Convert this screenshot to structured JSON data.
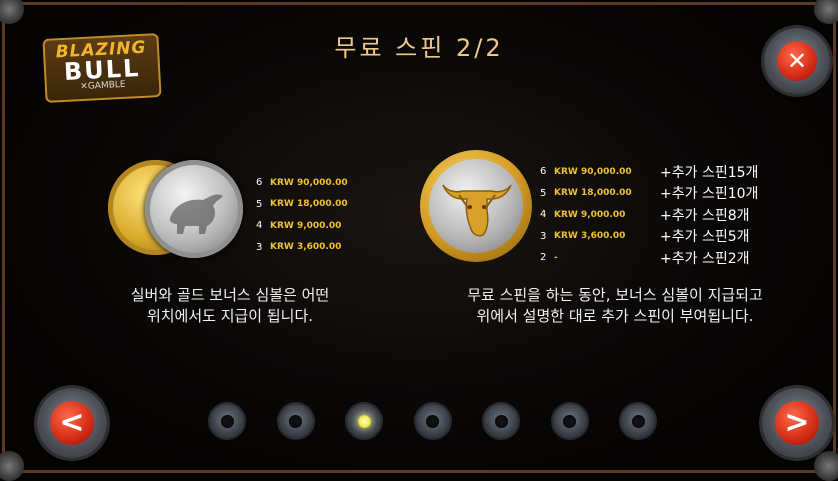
{
  "title": "무료 스핀 2/2",
  "logo": {
    "line1": "BLAZING",
    "line2": "BULL",
    "line3": "✕GAMBLE"
  },
  "buttons": {
    "close": "✕",
    "prev": "<",
    "next": ">"
  },
  "left_paytable": [
    {
      "count": "6",
      "value": "KRW 90,000.00"
    },
    {
      "count": "5",
      "value": "KRW 18,000.00"
    },
    {
      "count": "4",
      "value": "KRW 9,000.00"
    },
    {
      "count": "3",
      "value": "KRW 3,600.00"
    }
  ],
  "right_paytable": [
    {
      "count": "6",
      "value": "KRW 90,000.00",
      "spins": "+추가 스핀15개"
    },
    {
      "count": "5",
      "value": "KRW 18,000.00",
      "spins": "+추가 스핀10개"
    },
    {
      "count": "4",
      "value": "KRW 9,000.00",
      "spins": "+추가 스핀8개"
    },
    {
      "count": "3",
      "value": "KRW 3,600.00",
      "spins": "+추가 스핀5개"
    },
    {
      "count": "2",
      "value": "-",
      "spins": "+추가 스핀2개"
    }
  ],
  "desc_left": {
    "line1": "실버와 골드 보너스 심볼은 어떤",
    "line2": "위치에서도 지급이 됩니다."
  },
  "desc_right": {
    "line1": "무료 스핀을 하는 동안, 보너스 심볼이 지급되고",
    "line2": "위에서 설명한 대로 추가 스핀이 부여됩니다."
  },
  "pagination": {
    "total": 7,
    "active_index": 2
  }
}
